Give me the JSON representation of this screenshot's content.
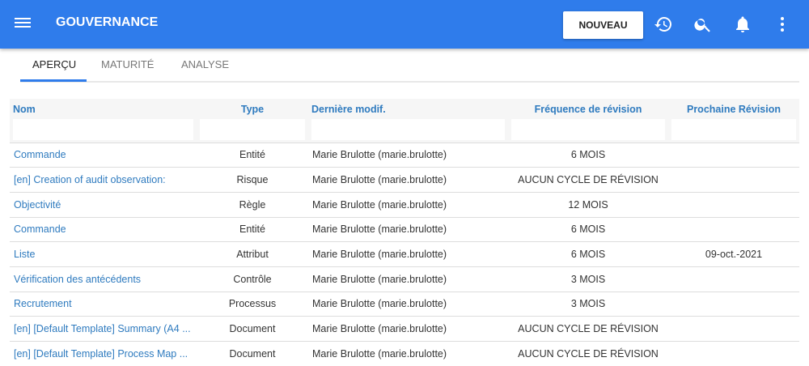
{
  "header": {
    "title": "GOUVERNANCE",
    "new_button": "NOUVEAU"
  },
  "tabs": [
    "APERÇU",
    "MATURITÉ",
    "ANALYSE"
  ],
  "table": {
    "columns": [
      "Nom",
      "Type",
      "Dernière modif.",
      "Fréquence de révision",
      "Prochaine Révision"
    ],
    "rows": [
      [
        "Commande",
        "Entité",
        "Marie Brulotte (marie.brulotte)",
        "6 MOIS",
        ""
      ],
      [
        "[en] Creation of audit observation:",
        "Risque",
        "Marie Brulotte (marie.brulotte)",
        "AUCUN CYCLE DE RÉVISION",
        ""
      ],
      [
        "Objectivité",
        "Règle",
        "Marie Brulotte (marie.brulotte)",
        "12 MOIS",
        ""
      ],
      [
        "Commande",
        "Entité",
        "Marie Brulotte (marie.brulotte)",
        "6 MOIS",
        ""
      ],
      [
        "Liste",
        "Attribut",
        "Marie Brulotte (marie.brulotte)",
        "6 MOIS",
        "09-oct.-2021"
      ],
      [
        "Vérification des antécédents",
        "Contrôle",
        "Marie Brulotte (marie.brulotte)",
        "3 MOIS",
        ""
      ],
      [
        "Recrutement",
        "Processus",
        "Marie Brulotte (marie.brulotte)",
        "3 MOIS",
        ""
      ],
      [
        "[en] [Default Template] Summary (A4 ...",
        "Document",
        "Marie Brulotte (marie.brulotte)",
        "AUCUN CYCLE DE RÉVISION",
        ""
      ],
      [
        "[en] [Default Template] Process Map ...",
        "Document",
        "Marie Brulotte (marie.brulotte)",
        "AUCUN CYCLE DE RÉVISION",
        ""
      ]
    ]
  }
}
